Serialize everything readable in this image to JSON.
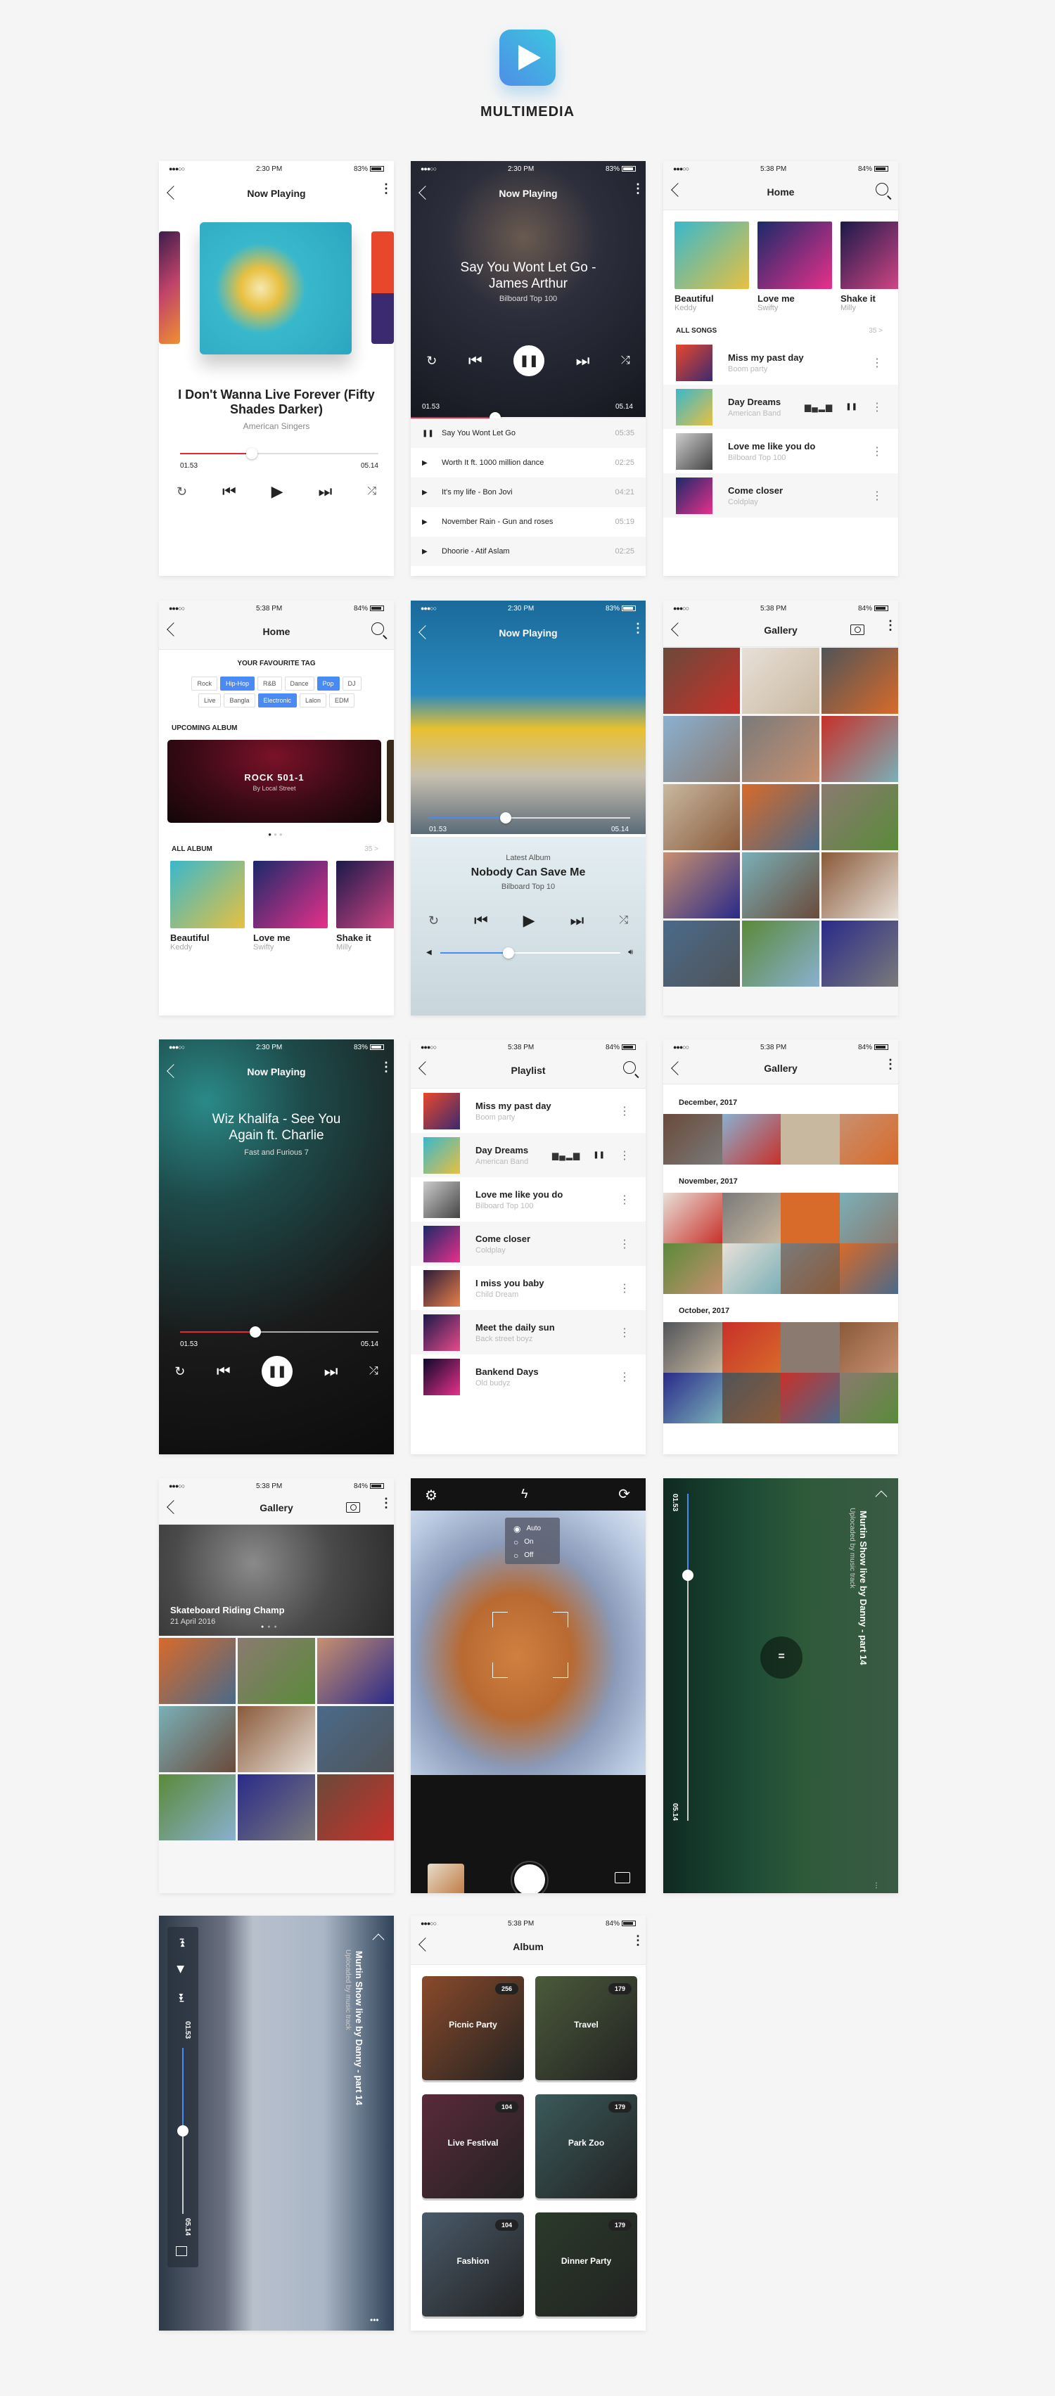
{
  "brand": {
    "title": "MULTIMEDIA"
  },
  "status": {
    "time_a": "2:30 PM",
    "battery_a": "83%",
    "time_b": "5:38 PM",
    "battery_b": "84%",
    "signal": "●●●○○",
    "wifi": "◠"
  },
  "colors": {
    "accent_red": "#e8253a",
    "accent_blue": "#4a8af4",
    "brand_gradient_start": "#4f8ee6",
    "brand_gradient_end": "#3cc6e0"
  },
  "screen1": {
    "title": "Now Playing",
    "song": "I Don't Wanna Live Forever (Fifty Shades Darker)",
    "artist": "American Singers",
    "elapsed": "01.53",
    "total": "05.14",
    "progress": 0.36
  },
  "screen2": {
    "title": "Now Playing",
    "song": "Say You Wont Let Go - James Arthur",
    "subtitle": "Bilboard Top 100",
    "elapsed": "01.53",
    "total": "05.14",
    "progress": 0.36,
    "tracks": [
      {
        "name": "Say You Wont Let Go",
        "duration": "05:35",
        "state": "pause"
      },
      {
        "name": "Worth It ft. 1000 million dance",
        "duration": "02:25",
        "state": "play"
      },
      {
        "name": "It's my life - Bon Jovi",
        "duration": "04:21",
        "state": "play"
      },
      {
        "name": "November Rain - Gun and roses",
        "duration": "05:19",
        "state": "play"
      },
      {
        "name": "Dhoorie - Atif Aslam",
        "duration": "02:25",
        "state": "play"
      }
    ]
  },
  "screen3": {
    "title": "Home",
    "albums": [
      {
        "title": "Beautiful",
        "artist": "Keddy"
      },
      {
        "title": "Love me",
        "artist": "Swifty"
      },
      {
        "title": "Shake it",
        "artist": "Milly"
      }
    ],
    "section": "ALL SONGS",
    "count": "35 >",
    "songs": [
      {
        "title": "Miss my past day",
        "artist": "Boom party"
      },
      {
        "title": "Day Dreams",
        "artist": "American Band",
        "playing": true
      },
      {
        "title": "Love me like you do",
        "artist": "Bilboard Top 100"
      },
      {
        "title": "Come closer",
        "artist": "Coldplay"
      }
    ]
  },
  "screen4": {
    "title": "Home",
    "tag_heading": "YOUR FAVOURITE TAG",
    "tags": [
      {
        "label": "Rock",
        "on": false
      },
      {
        "label": "Hip-Hop",
        "on": true
      },
      {
        "label": "R&B",
        "on": false
      },
      {
        "label": "Dance",
        "on": false
      },
      {
        "label": "Pop",
        "on": true
      },
      {
        "label": "DJ",
        "on": false
      },
      {
        "label": "Live",
        "on": false
      },
      {
        "label": "Bangla",
        "on": false
      },
      {
        "label": "Electronic",
        "on": true
      },
      {
        "label": "Lalon",
        "on": false
      },
      {
        "label": "EDM",
        "on": false
      }
    ],
    "upcoming_heading": "UPCOMING ALBUM",
    "banner_title": "ROCK 501-1",
    "banner_sub": "By Local Street",
    "all_album_heading": "ALL ALBUM",
    "count": "35 >",
    "albums": [
      {
        "title": "Beautiful",
        "artist": "Keddy"
      },
      {
        "title": "Love me",
        "artist": "Swifty"
      },
      {
        "title": "Shake it",
        "artist": "Milly"
      }
    ]
  },
  "screen5": {
    "title": "Now Playing",
    "elapsed": "01.53",
    "total": "05.14",
    "progress": 0.38,
    "label": "Latest Album",
    "song": "Nobody Can Save Me",
    "subtitle": "Bilboard Top 10",
    "volume": 0.38
  },
  "screen6": {
    "title": "Gallery"
  },
  "screen7": {
    "title": "Now Playing",
    "song": "Wiz Khalifa - See You Again ft. Charlie",
    "subtitle": "Fast and Furious 7",
    "elapsed": "01.53",
    "total": "05.14",
    "progress": 0.38
  },
  "screen8": {
    "title": "Playlist",
    "songs": [
      {
        "title": "Miss my past day",
        "artist": "Boom party"
      },
      {
        "title": "Day Dreams",
        "artist": "American Band",
        "playing": true
      },
      {
        "title": "Love me like you do",
        "artist": "Bilboard Top 100"
      },
      {
        "title": "Come closer",
        "artist": "Coldplay"
      },
      {
        "title": "I miss you baby",
        "artist": "Child Dream"
      },
      {
        "title": "Meet the daily sun",
        "artist": "Back street boyz"
      },
      {
        "title": "Bankend Days",
        "artist": "Old budyz"
      }
    ]
  },
  "screen9": {
    "title": "Gallery",
    "sections": [
      "December, 2017",
      "November, 2017",
      "October, 2017"
    ]
  },
  "screen10": {
    "title": "Gallery",
    "feature_title": "Skateboard Riding Champ",
    "feature_date": "21 April 2016"
  },
  "screen11": {
    "flash_options": [
      {
        "label": "Auto",
        "selected": true
      },
      {
        "label": "On",
        "selected": false
      },
      {
        "label": "Off",
        "selected": false
      }
    ]
  },
  "screen12": {
    "title": "Murtin Show live by Danny - part 14",
    "subtitle": "Uplocaded by music track",
    "elapsed": "01.53",
    "total": "05.14",
    "progress": 0.25
  },
  "screen13": {
    "title": "Murtin Show live by Danny - part 14",
    "subtitle": "Uplocaded by music track",
    "elapsed": "01.53",
    "total": "05.14",
    "progress": 0.5
  },
  "screen14": {
    "title": "Album",
    "albums": [
      {
        "name": "Picnic Party",
        "count": "256"
      },
      {
        "name": "Travel",
        "count": "179"
      },
      {
        "name": "Live Festival",
        "count": "104"
      },
      {
        "name": "Park Zoo",
        "count": "179"
      },
      {
        "name": "Fashion",
        "count": "104"
      },
      {
        "name": "Dinner Party",
        "count": "179"
      }
    ]
  }
}
